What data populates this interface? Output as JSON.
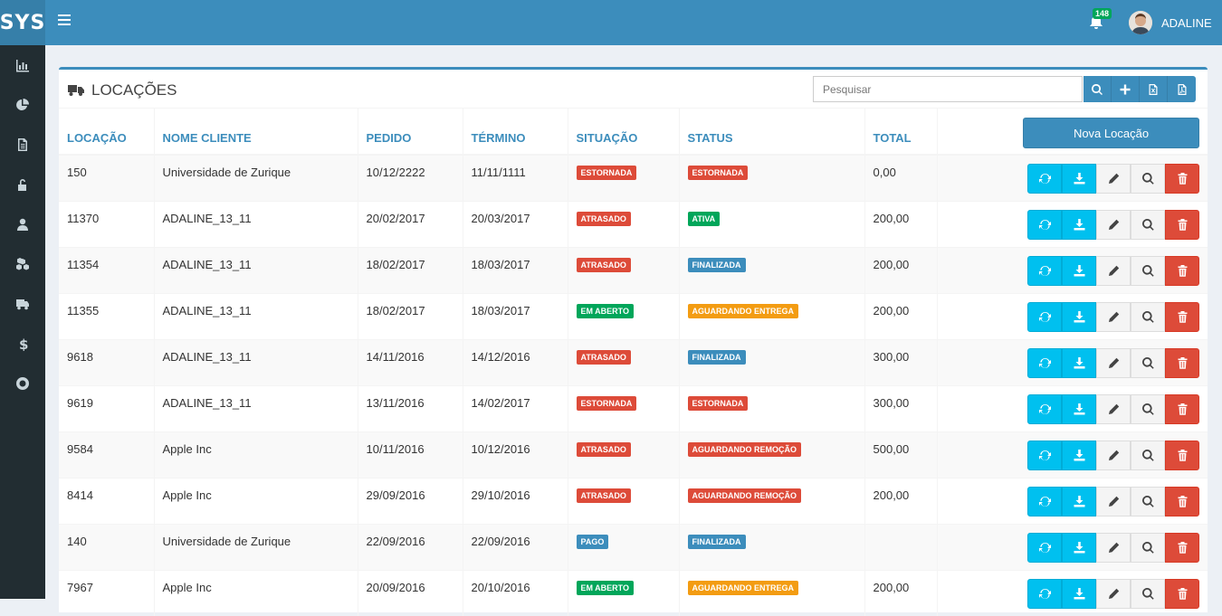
{
  "app": {
    "logo": "SYS"
  },
  "sidebar": {
    "icons": [
      "bar-chart-icon",
      "pie-chart-icon",
      "document-icon",
      "unlock-icon",
      "user-icon",
      "cubes-icon",
      "truck-icon",
      "dollar-icon",
      "support-icon"
    ]
  },
  "topbar": {
    "notifications": "148",
    "user": "ADALINE"
  },
  "page": {
    "title": "LOCAÇÕES",
    "search_placeholder": "Pesquisar",
    "new_button": "Nova Locação"
  },
  "table": {
    "headers": [
      "LOCAÇÃO",
      "NOME CLIENTE",
      "PEDIDO",
      "TÉRMINO",
      "SITUAÇÃO",
      "STATUS",
      "TOTAL"
    ],
    "rows": [
      {
        "id": "150",
        "client": "Universidade de Zurique",
        "ordered": "10/12/2222",
        "end": "11/11/1111",
        "situation": "ESTORNADA",
        "situation_color": "#dd4b39",
        "status": "ESTORNADA",
        "status_color": "#dd4b39",
        "total": "0,00"
      },
      {
        "id": "11370",
        "client": "ADALINE_13_11",
        "ordered": "20/02/2017",
        "end": "20/03/2017",
        "situation": "ATRASADO",
        "situation_color": "#dd4b39",
        "status": "ATIVA",
        "status_color": "#00a65a",
        "total": "200,00"
      },
      {
        "id": "11354",
        "client": "ADALINE_13_11",
        "ordered": "18/02/2017",
        "end": "18/03/2017",
        "situation": "ATRASADO",
        "situation_color": "#dd4b39",
        "status": "FINALIZADA",
        "status_color": "#3c8dbc",
        "total": "200,00"
      },
      {
        "id": "11355",
        "client": "ADALINE_13_11",
        "ordered": "18/02/2017",
        "end": "18/03/2017",
        "situation": "EM ABERTO",
        "situation_color": "#00a65a",
        "status": "AGUARDANDO ENTREGA",
        "status_color": "#f39c12",
        "total": "200,00"
      },
      {
        "id": "9618",
        "client": "ADALINE_13_11",
        "ordered": "14/11/2016",
        "end": "14/12/2016",
        "situation": "ATRASADO",
        "situation_color": "#dd4b39",
        "status": "FINALIZADA",
        "status_color": "#3c8dbc",
        "total": "300,00"
      },
      {
        "id": "9619",
        "client": "ADALINE_13_11",
        "ordered": "13/11/2016",
        "end": "14/02/2017",
        "situation": "ESTORNADA",
        "situation_color": "#dd4b39",
        "status": "ESTORNADA",
        "status_color": "#dd4b39",
        "total": "300,00"
      },
      {
        "id": "9584",
        "client": "Apple Inc",
        "ordered": "10/11/2016",
        "end": "10/12/2016",
        "situation": "ATRASADO",
        "situation_color": "#dd4b39",
        "status": "AGUARDANDO REMOÇÃO",
        "status_color": "#dd4b39",
        "total": "500,00"
      },
      {
        "id": "8414",
        "client": "Apple Inc",
        "ordered": "29/09/2016",
        "end": "29/10/2016",
        "situation": "ATRASADO",
        "situation_color": "#dd4b39",
        "status": "AGUARDANDO REMOÇÃO",
        "status_color": "#dd4b39",
        "total": "200,00"
      },
      {
        "id": "140",
        "client": "Universidade de Zurique",
        "ordered": "22/09/2016",
        "end": "22/09/2016",
        "situation": "PAGO",
        "situation_color": "#3c8dbc",
        "status": "FINALIZADA",
        "status_color": "#3c8dbc",
        "total": ""
      },
      {
        "id": "7967",
        "client": "Apple Inc",
        "ordered": "20/09/2016",
        "end": "20/10/2016",
        "situation": "EM ABERTO",
        "situation_color": "#00a65a",
        "status": "AGUARDANDO ENTREGA",
        "status_color": "#f39c12",
        "total": "200,00"
      }
    ]
  },
  "icons": {
    "refresh": "refresh-icon",
    "download": "download-icon",
    "edit": "pencil-icon",
    "view": "search-icon",
    "delete": "trash-icon"
  }
}
